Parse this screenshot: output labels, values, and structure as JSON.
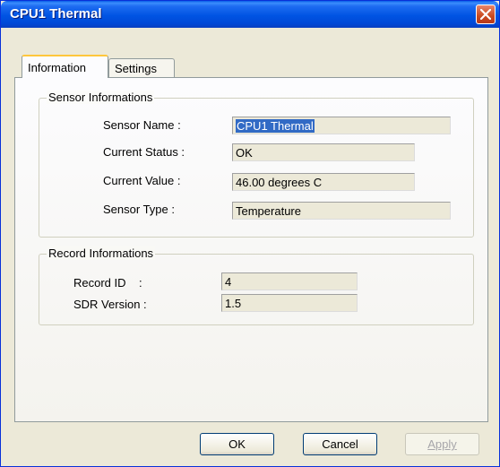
{
  "window": {
    "title": "CPU1 Thermal"
  },
  "tabs": [
    {
      "label": "Information"
    },
    {
      "label": "Settings"
    }
  ],
  "sensor_group": {
    "legend": "Sensor Informations",
    "fields": [
      {
        "label": "Sensor Name :",
        "value": "CPU1 Thermal"
      },
      {
        "label": "Current Status :",
        "value": "OK"
      },
      {
        "label": "Current Value :",
        "value": "46.00 degrees C"
      },
      {
        "label": "Sensor Type  :",
        "value": "Temperature"
      }
    ]
  },
  "record_group": {
    "legend": "Record Informations",
    "fields": [
      {
        "label": "Record ID    :",
        "value": "4"
      },
      {
        "label": "SDR Version :",
        "value": "1.5"
      }
    ]
  },
  "buttons": {
    "ok": "OK",
    "cancel": "Cancel",
    "apply": "Apply"
  }
}
